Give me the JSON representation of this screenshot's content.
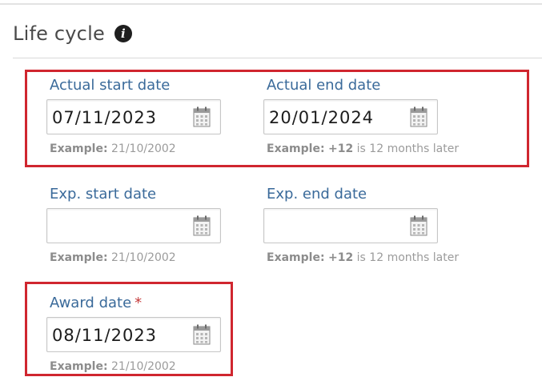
{
  "section": {
    "title": "Life cycle",
    "info_icon": "info-circle-icon"
  },
  "actual_start": {
    "label": "Actual start date",
    "value": "07/11/2023",
    "example_prefix": "Example:",
    "example_text": "21/10/2002"
  },
  "actual_end": {
    "label": "Actual end date",
    "value": "20/01/2024",
    "example_prefix": "Example:",
    "example_value": "+12",
    "example_text": "is 12 months later"
  },
  "exp_start": {
    "label": "Exp. start date",
    "value": "",
    "example_prefix": "Example:",
    "example_text": "21/10/2002"
  },
  "exp_end": {
    "label": "Exp. end date",
    "value": "",
    "example_prefix": "Example:",
    "example_value": "+12",
    "example_text": "is 12 months later"
  },
  "award": {
    "label": "Award date",
    "required_mark": "*",
    "value": "08/11/2023",
    "example_prefix": "Example:",
    "example_text": "21/10/2002"
  },
  "colors": {
    "label": "#3a6a9a",
    "highlight": "#d0262f",
    "required": "#c43a3a"
  }
}
